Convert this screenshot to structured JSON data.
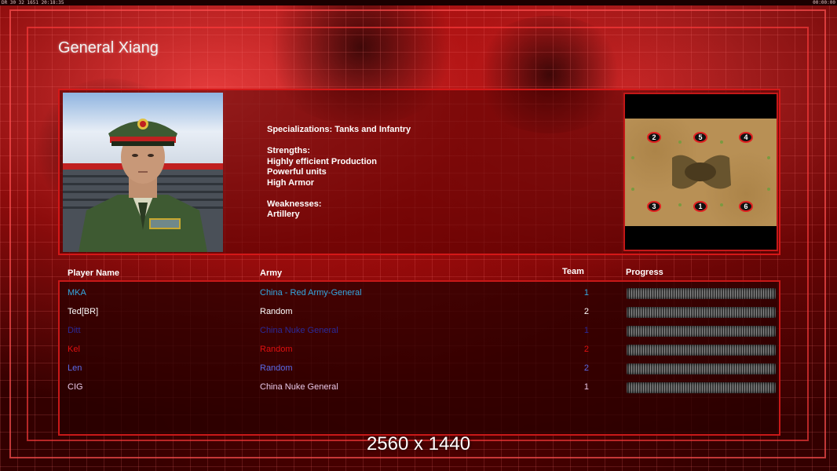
{
  "system_bar": {
    "left": "DR 30 32 1651 20:18:35",
    "right": "00:00:00"
  },
  "general": {
    "title": "General Xiang",
    "specializations": "Specializations: Tanks and Infantry",
    "strengths_label": "Strengths:",
    "strengths": [
      "Highly efficient Production",
      "Powerful units",
      "High Armor"
    ],
    "weaknesses_label": "Weaknesses:",
    "weaknesses": [
      "Artillery"
    ]
  },
  "minimap": {
    "start_positions": [
      "2",
      "5",
      "4",
      "3",
      "1",
      "6"
    ]
  },
  "table": {
    "headers": {
      "player": "Player Name",
      "army": "Army",
      "team": "Team",
      "progress": "Progress"
    },
    "rows": [
      {
        "name": "MKA",
        "army": "China - Red Army-General",
        "team": "1",
        "color": "#33a8e0",
        "progress": 1.0
      },
      {
        "name": "Ted[BR]",
        "army": "Random",
        "team": "2",
        "color": "#ffffff",
        "progress": 1.0
      },
      {
        "name": "Ditt",
        "army": "China Nuke General",
        "team": "1",
        "color": "#2a2a9a",
        "progress": 1.0
      },
      {
        "name": "Kel",
        "army": "Random",
        "team": "2",
        "color": "#e01010",
        "progress": 1.0
      },
      {
        "name": "Len",
        "army": "Random",
        "team": "2",
        "color": "#5a6ae8",
        "progress": 1.0
      },
      {
        "name": "CIG",
        "army": "China Nuke General",
        "team": "1",
        "color": "#e8c8e8",
        "progress": 1.0
      }
    ]
  },
  "resolution_label": "2560 x 1440",
  "colors": {
    "accent": "#d41818",
    "background": "#600000"
  }
}
